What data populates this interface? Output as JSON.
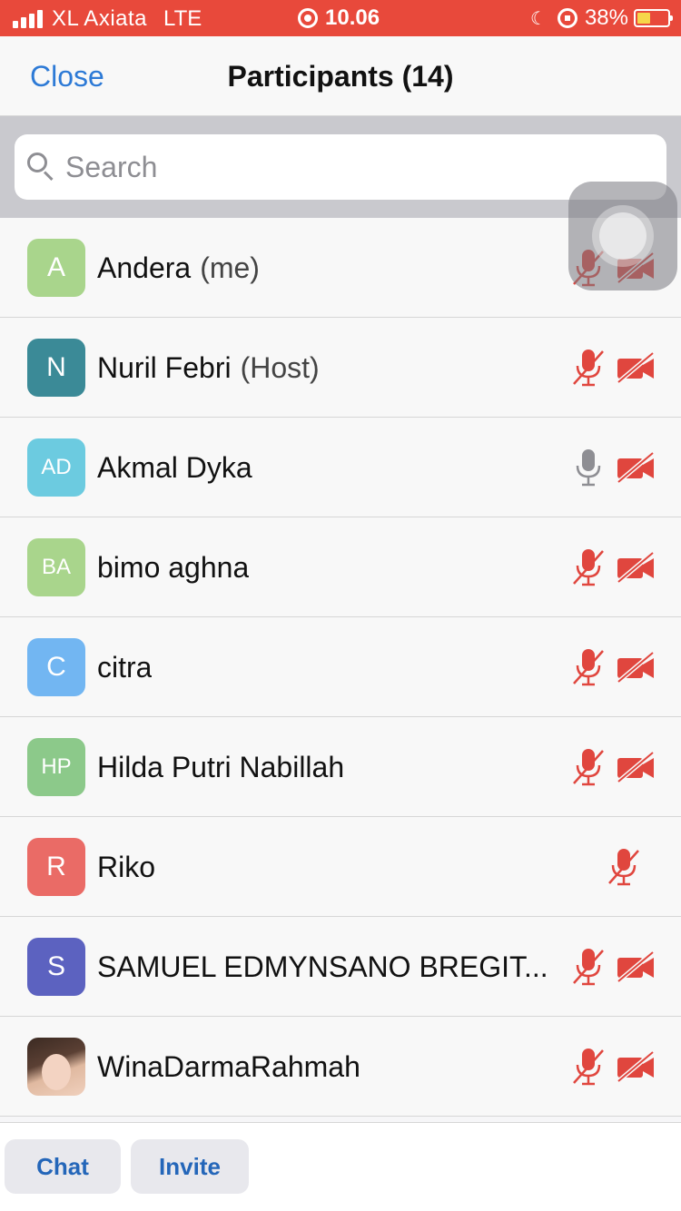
{
  "status_bar": {
    "carrier": "XL Axiata",
    "network": "LTE",
    "time": "10.06",
    "battery": "38%",
    "color": "#e8493b"
  },
  "nav": {
    "close_label": "Close",
    "title": "Participants (14)"
  },
  "search": {
    "placeholder": "Search",
    "value": ""
  },
  "participants": [
    {
      "initials": "A",
      "name": "Andera",
      "tag": "(me)",
      "avatar_color": "#a9d58c",
      "mic": "muted",
      "video": "off"
    },
    {
      "initials": "N",
      "name": "Nuril Febri",
      "tag": "(Host)",
      "avatar_color": "#3b8a97",
      "mic": "muted",
      "video": "off"
    },
    {
      "initials": "AD",
      "name": "Akmal Dyka",
      "tag": "",
      "avatar_color": "#6ccbe0",
      "mic": "on",
      "video": "off"
    },
    {
      "initials": "BA",
      "name": "bimo aghna",
      "tag": "",
      "avatar_color": "#a9d58c",
      "mic": "muted",
      "video": "off"
    },
    {
      "initials": "C",
      "name": "citra",
      "tag": "",
      "avatar_color": "#72b6f2",
      "mic": "muted",
      "video": "off"
    },
    {
      "initials": "HP",
      "name": "Hilda Putri Nabillah",
      "tag": "",
      "avatar_color": "#8cc98a",
      "mic": "muted",
      "video": "off"
    },
    {
      "initials": "R",
      "name": "Riko",
      "tag": "",
      "avatar_color": "#ea6b66",
      "mic": "muted",
      "video": "none"
    },
    {
      "initials": "S",
      "name": "SAMUEL EDMYNSANO BREGIT...",
      "tag": "",
      "avatar_color": "#5c62c0",
      "mic": "muted",
      "video": "off"
    },
    {
      "initials": "",
      "name": "WinaDarmaRahmah",
      "tag": "",
      "avatar_color": "photo",
      "mic": "muted",
      "video": "off"
    }
  ],
  "icons": {
    "muted_color": "#e0463e",
    "unmuted_color": "#8e8e93"
  },
  "footer": {
    "chat_label": "Chat",
    "invite_label": "Invite"
  }
}
